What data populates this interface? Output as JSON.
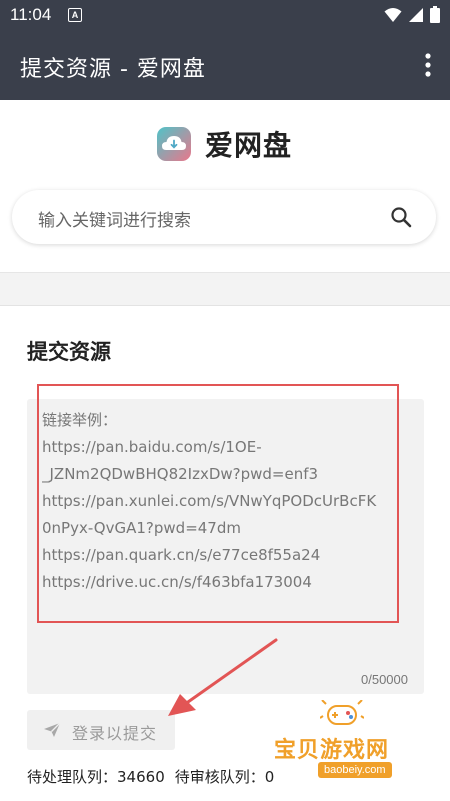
{
  "status_bar": {
    "time": "11:04",
    "notification_badge": "A",
    "icons": [
      "wifi-icon",
      "signal-icon",
      "battery-icon"
    ]
  },
  "app_bar": {
    "title": "提交资源 - 爱网盘",
    "menu_icon": "more-vert-icon"
  },
  "header": {
    "brand_name": "爱网盘",
    "logo_icon": "cloud-download-icon",
    "search": {
      "placeholder": "输入关键词进行搜索",
      "icon": "search-icon"
    }
  },
  "submit_section": {
    "title": "提交资源",
    "textarea": {
      "value": "",
      "placeholder_lines": [
        "链接举例：",
        "https://pan.baidu.com/s/1OE-",
        "_JZNm2QDwBHQ82IzxDw?pwd=enf3",
        "https://pan.xunlei.com/s/VNwYqPODcUrBcFK",
        "0nPyx-QvGA1?pwd=47dm",
        "https://pan.quark.cn/s/e77ce8f55a24",
        "https://drive.uc.cn/s/f463bfa173004"
      ],
      "counter": "0/50000"
    },
    "submit_button": {
      "label": "登录以提交",
      "icon": "send-icon",
      "enabled": false
    },
    "queue": {
      "pending_label": "待处理队列：",
      "pending_value": "34660",
      "review_label": "待审核队列：",
      "review_value": "0"
    }
  },
  "annotation": {
    "highlight_color": "#e25555",
    "arrow_color": "#e25555"
  },
  "watermark": {
    "text": "宝贝游戏网",
    "url": "baobeiy.com",
    "color": "#f0a02a"
  },
  "colors": {
    "app_bar": "#3a3f4b",
    "page_background": "#f3f3f3",
    "textarea_background": "#f2f2f2",
    "disabled_text": "#9a9a9a"
  }
}
